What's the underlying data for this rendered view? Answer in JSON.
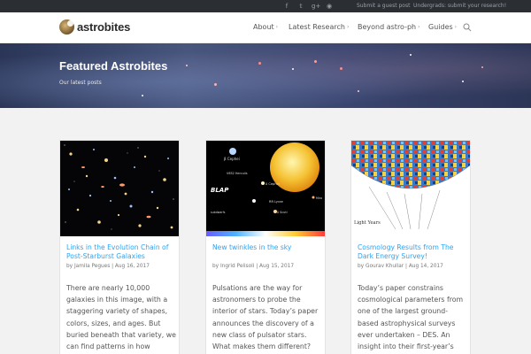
{
  "topbar": {
    "social_icons": [
      "facebook-icon",
      "twitter-icon",
      "google-plus-icon",
      "rss-icon"
    ],
    "guest_link": "Submit a guest post",
    "undergrad_link": "Undergrads: submit your research!"
  },
  "header": {
    "logo_text": "astrobites",
    "nav": [
      {
        "label": "About",
        "chevron": "›"
      },
      {
        "label": "Latest Research",
        "chevron": "›"
      },
      {
        "label": "Beyond astro-ph",
        "chevron": "›"
      },
      {
        "label": "Guides",
        "chevron": "›"
      }
    ]
  },
  "hero": {
    "title": "Featured Astrobites",
    "subtitle": "Our latest posts"
  },
  "cards": [
    {
      "title": "Links in the Evolution Chain of Post-Starburst Galaxies",
      "meta": "by Jamila Pegues | Aug 16, 2017",
      "excerpt": "There are nearly 10,000 galaxies in this image, with a staggering variety of shapes, colors, sizes, and ages. But buried beneath that variety, we can find patterns in how"
    },
    {
      "title": "New twinkles in the sky",
      "meta": "by Ingrid Pelisoli | Aug 15, 2017",
      "excerpt": "Pulsations are the way for astronomers to probe the interior of stars. Today’s paper announces the discovery of a new class of pulsator stars. What makes them different? And what exciting new things",
      "image_labels": {
        "cepheid_top": "β Cephei",
        "v652": "V652 Herculis",
        "blap": "BLAP",
        "delta_scuti": "δ Scuti",
        "cepheid_right": "δ Cephei",
        "rr_lyrae": "RR Lyrae",
        "mira": "Mira",
        "subdwarfs": "subdwarfs",
        "delta_cep_small": "δ Scuti"
      }
    },
    {
      "title": "Cosmology Results from The Dark Energy Survey!",
      "meta": "by Gourav Khullar | Aug 14, 2017",
      "excerpt": "Today’s paper constrains cosmological parameters from one of the largest ground-based astrophysical surveys ever undertaken – DES. An insight into their first-year’s",
      "image_labels": {
        "axis": "Light Years"
      }
    }
  ]
}
